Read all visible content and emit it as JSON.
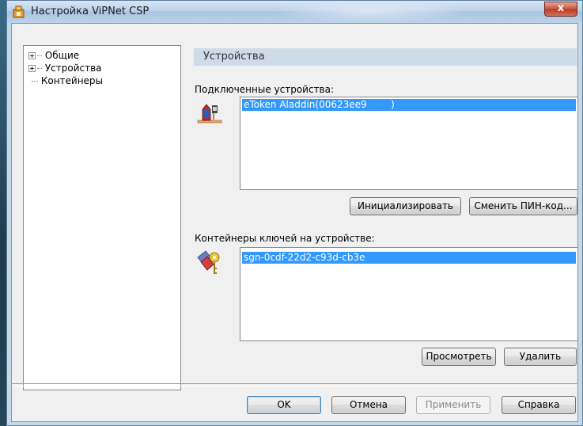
{
  "window": {
    "title": "Настройка ViPNet CSP",
    "close_label": "x"
  },
  "tree": {
    "items": [
      {
        "label": "Общие",
        "expandable": true
      },
      {
        "label": "Устройства",
        "expandable": true
      },
      {
        "label": "Контейнеры",
        "expandable": false
      }
    ]
  },
  "devices": {
    "header": "Устройства",
    "connected_label": "Подключенные устройства:",
    "connected_list": [
      "eToken Aladdin(00623ee9        )"
    ],
    "init_button": "Инициализировать",
    "change_pin_button": "Сменить ПИН-код...",
    "containers_label": "Контейнеры ключей на устройстве:",
    "containers_list": [
      "sgn-0cdf-22d2-c93d-cb3e"
    ],
    "view_button": "Просмотреть",
    "delete_button": "Удалить"
  },
  "footer": {
    "ok": "OK",
    "cancel": "Отмена",
    "apply": "Применить",
    "help": "Справка"
  },
  "colors": {
    "selection": "#3399ff",
    "header_bg": "#cedbe8"
  },
  "icons": {
    "device": "usb-token-icon",
    "container": "keys-icon",
    "app": "vipnet-app-icon"
  }
}
